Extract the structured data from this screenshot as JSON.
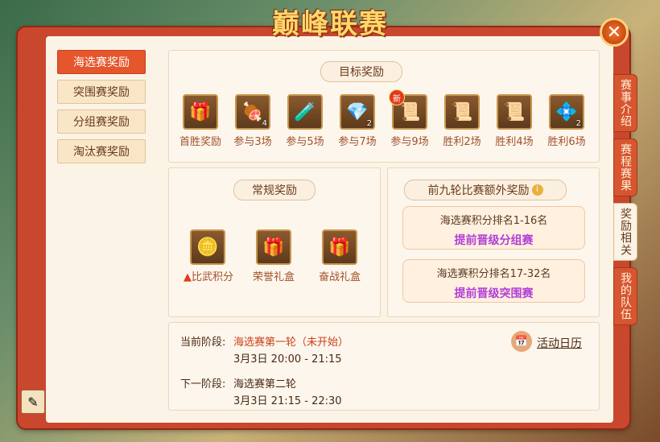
{
  "title": "巅峰联赛",
  "close_label": "✕",
  "left_nav": [
    {
      "label": "海选赛奖励",
      "active": true
    },
    {
      "label": "突围赛奖励",
      "active": false
    },
    {
      "label": "分组赛奖励",
      "active": false
    },
    {
      "label": "淘汰赛奖励",
      "active": false
    }
  ],
  "side_tabs": [
    {
      "label": "赛事介绍",
      "active": false
    },
    {
      "label": "赛程赛果",
      "active": false
    },
    {
      "label": "奖励相关",
      "active": true
    },
    {
      "label": "我的队伍",
      "active": false
    }
  ],
  "target": {
    "title": "目标奖励",
    "items": [
      {
        "icon": "gift-box-icon",
        "glyph": "🎁",
        "label": "首胜奖励",
        "count": ""
      },
      {
        "icon": "food-items-icon",
        "glyph": "🍖",
        "label": "参与3场",
        "count": "4"
      },
      {
        "icon": "potion-bottle-icon",
        "glyph": "🧪",
        "label": "参与5场",
        "count": ""
      },
      {
        "icon": "crystal-pile-icon",
        "glyph": "💎",
        "label": "参与7场",
        "count": "2"
      },
      {
        "icon": "scroll-icon",
        "glyph": "📜",
        "label": "参与9场",
        "count": "",
        "badge": "新"
      },
      {
        "icon": "scroll-icon",
        "glyph": "📜",
        "label": "胜利2场",
        "count": ""
      },
      {
        "icon": "scroll-icon",
        "glyph": "📜",
        "label": "胜利4场",
        "count": ""
      },
      {
        "icon": "crystal-icon",
        "glyph": "💠",
        "label": "胜利6场",
        "count": "2"
      }
    ]
  },
  "regular": {
    "title": "常规奖励",
    "items": [
      {
        "icon": "medal-coin-icon",
        "glyph": "🪙",
        "label": "比武积分"
      },
      {
        "icon": "honor-gift-icon",
        "glyph": "🎁",
        "label": "荣誉礼盒"
      },
      {
        "icon": "battle-gift-icon",
        "glyph": "🎁",
        "label": "奋战礼盒"
      }
    ]
  },
  "extra": {
    "title": "前九轮比赛额外奖励",
    "ranks": [
      {
        "line1": "海选赛积分排名1-16名",
        "line2": "提前晋级分组赛"
      },
      {
        "line1": "海选赛积分排名17-32名",
        "line2": "提前晋级突围赛"
      }
    ]
  },
  "stage": {
    "current_label": "当前阶段:",
    "current_value": "海选赛第一轮（未开始）",
    "current_time": "3月3日  20:00 - 21:15",
    "next_label": "下一阶段:",
    "next_value": "海选赛第二轮",
    "next_time": "3月3日  21:15 - 22:30",
    "calendar_label": "活动日历"
  }
}
